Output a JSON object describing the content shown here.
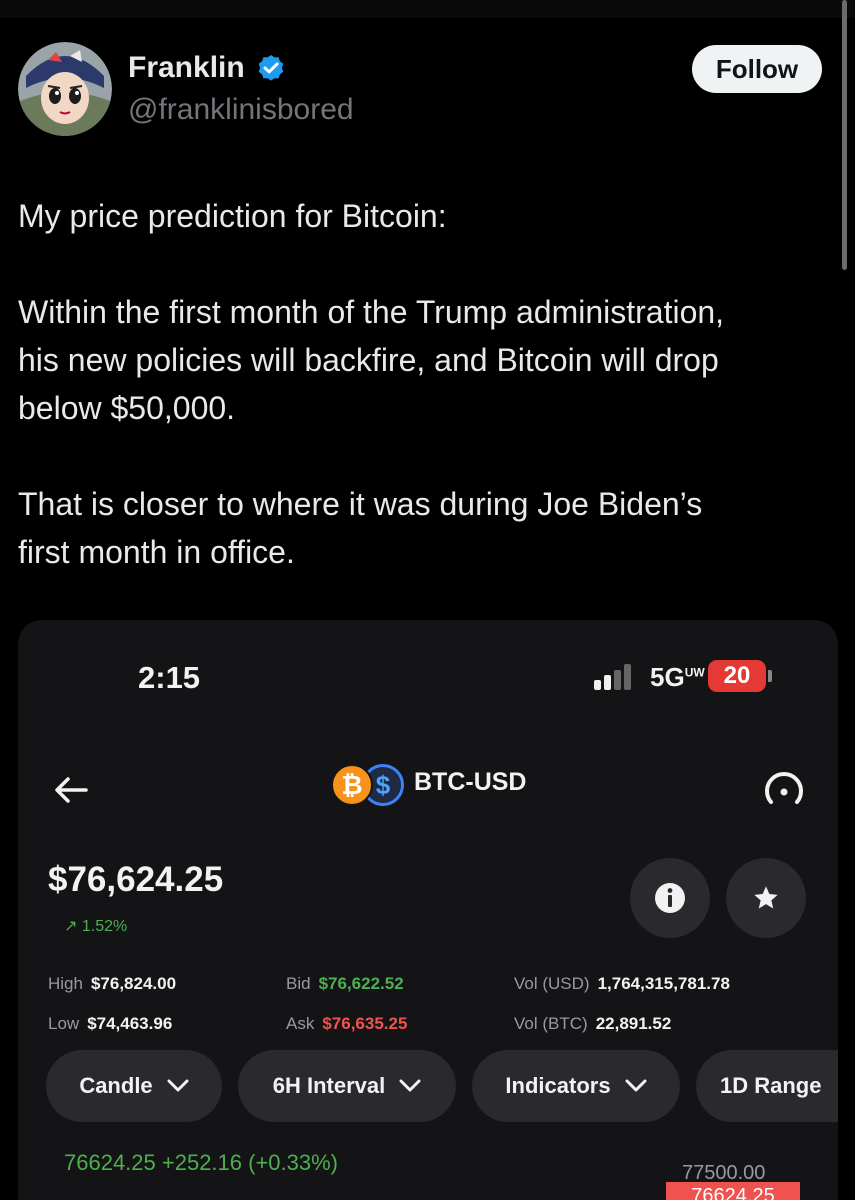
{
  "post": {
    "author": {
      "name": "Franklin",
      "handle": "@franklinisbored",
      "verified": true
    },
    "follow_label": "Follow",
    "text": {
      "p1": "My price prediction for Bitcoin:",
      "p2_line1": "Within the first month of the Trump administration,",
      "p2_line2": "his new policies will backfire, and Bitcoin will drop",
      "p2_line3": "below $50,000.",
      "p3_line1": "That is closer to where it was during Joe Biden’s",
      "p3_line2": "first month in office."
    }
  },
  "embedded": {
    "status_bar": {
      "time": "2:15",
      "network": "5G",
      "network_sup": "UW",
      "battery": "20"
    },
    "pair": "BTC-USD",
    "coins": {
      "base_symbol": "₿",
      "quote_symbol": "$"
    },
    "price": "$76,624.25",
    "change": "↗ 1.52%",
    "stats": {
      "high_label": "High",
      "high": "$76,824.00",
      "low_label": "Low",
      "low": "$74,463.96",
      "bid_label": "Bid",
      "bid": "$76,622.52",
      "ask_label": "Ask",
      "ask": "$76,635.25",
      "vol_usd_label": "Vol (USD)",
      "vol_usd": "1,764,315,781.78",
      "vol_btc_label": "Vol (BTC)",
      "vol_btc": "22,891.52"
    },
    "controls": {
      "candle": "Candle",
      "interval": "6H Interval",
      "indicators": "Indicators",
      "range": "1D Range"
    },
    "chart": {
      "quote_line": "76624.25 +252.16 (+0.33%)",
      "axis_price": "77500.00",
      "current_price_tag": "76624.25"
    },
    "colors": {
      "up": "#4caf50",
      "down": "#ef5350",
      "verified": "#1d9bf0",
      "btc": "#f7931a"
    }
  }
}
